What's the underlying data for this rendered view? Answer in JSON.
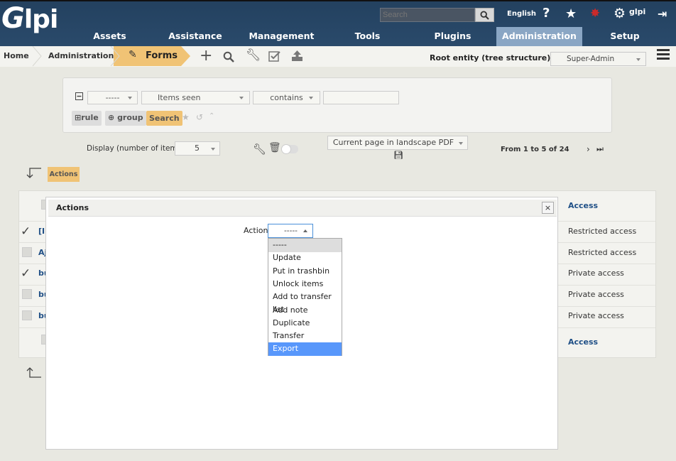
{
  "header": {
    "logo": "glpi",
    "search_placeholder": "Search",
    "language": "English",
    "username": "glpi",
    "menu": [
      {
        "label": "Assets"
      },
      {
        "label": "Assistance"
      },
      {
        "label": "Management"
      },
      {
        "label": "Tools"
      },
      {
        "label": "Plugins"
      },
      {
        "label": "Administration",
        "active": true
      },
      {
        "label": "Setup"
      }
    ]
  },
  "breadcrumb": {
    "home": "Home",
    "admin": "Administration",
    "forms": "Forms"
  },
  "entity": {
    "label": "Root entity (tree structure)",
    "profile": "Super-Admin"
  },
  "criteria": {
    "field1": "-----",
    "field2": "Items seen",
    "field3": "contains",
    "rule_btn": "rule",
    "group_btn": "group",
    "search_btn": "Search"
  },
  "display": {
    "label": "Display (number of items)",
    "count": "5",
    "export": "Current page in landscape PDF",
    "pager": "From 1 to 5 of 24"
  },
  "actions_label": "Actions",
  "table": {
    "header": "Access",
    "footer": "Access",
    "rows": [
      {
        "name": "[I",
        "access": "Restricted access",
        "checked": true
      },
      {
        "name": "Aj",
        "access": "Restricted access",
        "checked": false
      },
      {
        "name": "bu",
        "access": "Private access",
        "checked": true
      },
      {
        "name": "bu",
        "access": "Private access",
        "checked": false
      },
      {
        "name": "bu",
        "access": "Private access",
        "checked": false
      }
    ]
  },
  "modal": {
    "title": "Actions",
    "close": "×",
    "action_label": "Action",
    "selected": "-----",
    "options": [
      "-----",
      "Update",
      "Put in trashbin",
      "Unlock items",
      "Add to transfer list",
      "Add note",
      "Duplicate",
      "Transfer",
      "Export"
    ],
    "highlighted": "Export"
  },
  "colors": {
    "header_bg": "#23415f",
    "active_menu": "#8aa6c4",
    "gold": "#f0c375",
    "link": "#1f4f86",
    "dropdown_highlight": "#5897fb"
  }
}
